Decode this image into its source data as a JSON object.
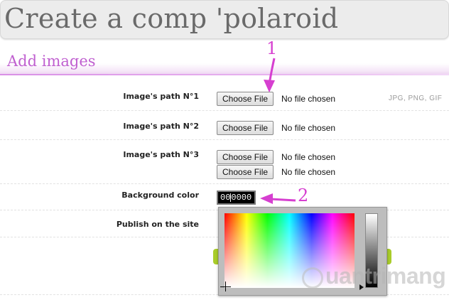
{
  "page": {
    "title": "Create a comp 'polaroid",
    "section_title": "Add images"
  },
  "form": {
    "rows": [
      {
        "label": "Image's path N°1"
      },
      {
        "label": "Image's path N°2"
      },
      {
        "label": "Image's path N°3"
      },
      {
        "label": "Background color"
      },
      {
        "label": "Publish on the site"
      }
    ],
    "file_button_label": "Choose File",
    "file_status": "No file chosen",
    "hint": "JPG, PNG, GIF",
    "color_value_before_caret": "00",
    "color_value_after_caret": "0000"
  },
  "annotations": {
    "marker_1": "1",
    "marker_2": "2",
    "color": "#d63fd0"
  },
  "watermark": {
    "text": "uantrimang"
  },
  "colors": {
    "accent": "#c060d0",
    "picker_bg": "#bdbdbd",
    "green": "#a9cc2a"
  }
}
